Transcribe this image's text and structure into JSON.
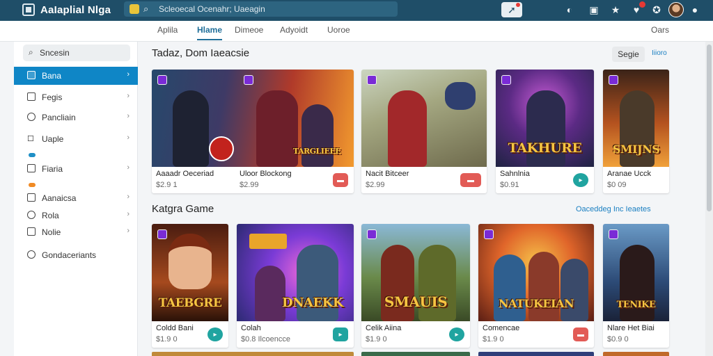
{
  "app": {
    "title": "AaIaplial Nlga"
  },
  "top_search": {
    "placeholder": "Scleoecal Ocenahr; Uaeagin"
  },
  "top_icons": [
    "share-icon",
    "circle-icon",
    "chat-icon",
    "star-icon",
    "notification-icon",
    "settings-icon",
    "avatar",
    "user-icon"
  ],
  "tabs": [
    {
      "label": "Aplila"
    },
    {
      "label": "Hlame",
      "active": true
    },
    {
      "label": "Dimeoe"
    },
    {
      "label": "Adyoidt"
    },
    {
      "label": "Uoroe"
    },
    {
      "label": "Oars"
    }
  ],
  "sidebar": {
    "search_placeholder": "Sncesin",
    "items": [
      {
        "label": "Bana",
        "icon": "grid-icon",
        "active": true
      },
      {
        "label": "Fegis",
        "icon": "list-icon"
      },
      {
        "label": "Pancliain",
        "icon": "gamepad-icon"
      },
      {
        "label": "Uaple",
        "icon": "category-icon"
      },
      {
        "label": "Fiaria",
        "icon": "folder-icon"
      },
      {
        "label": "Aanaicsa",
        "icon": "box-icon"
      },
      {
        "label": "Rola",
        "icon": "circle-icon"
      },
      {
        "label": "Nolie",
        "icon": "note-icon"
      },
      {
        "label": "Gondaceriants",
        "icon": "ring-icon"
      }
    ]
  },
  "main": {
    "title": "Tadaz, Dom Iaeacsie",
    "sort_label": "Segie",
    "view_link": "Iiioro",
    "section_title": "Katgra Game",
    "see_all": "Oaceddeg Inc Ieaetes"
  },
  "row1": [
    {
      "name": "Aaaadr Oeceriad",
      "price": "$2.9 1",
      "art_text": "",
      "action": "red"
    },
    {
      "name": "Uloor Blockong",
      "price": "$2.99",
      "art_text": "TARGLIEEE",
      "action": "red"
    },
    {
      "name": "Nacit Bitceer",
      "price": "$2.99",
      "art_text": "",
      "action": "red"
    },
    {
      "name": "Sahnlnia",
      "price": "$0.91",
      "art_text": "TAKHURE",
      "action": "teal"
    },
    {
      "name": "Aranae Ucck",
      "price": "$0 09",
      "art_text": "SMIJNS",
      "action": "teal"
    }
  ],
  "row2": [
    {
      "name": "Coldd Bani",
      "price": "$1.9 0",
      "art_text": "TAEBGRE",
      "action": "teal"
    },
    {
      "name": "Colah",
      "price": "$0.8 Ilcoencce",
      "art_text": "DNAEKK",
      "action": "teal"
    },
    {
      "name": "Celik Aiina",
      "price": "$1.9 0",
      "art_text": "SMAUIS",
      "action": "teal"
    },
    {
      "name": "Comencae",
      "price": "$1.9 0",
      "art_text": "NATUKEIAN",
      "action": "red"
    },
    {
      "name": "Nlare Het Biai",
      "price": "$0.9 0",
      "art_text": "TENIKE",
      "action": "teal"
    }
  ],
  "colors": {
    "topbar": "#1f4e68",
    "accent": "#0f86c6",
    "link": "#1a7fc1",
    "danger": "#e25b56",
    "teal": "#20a4a0"
  }
}
